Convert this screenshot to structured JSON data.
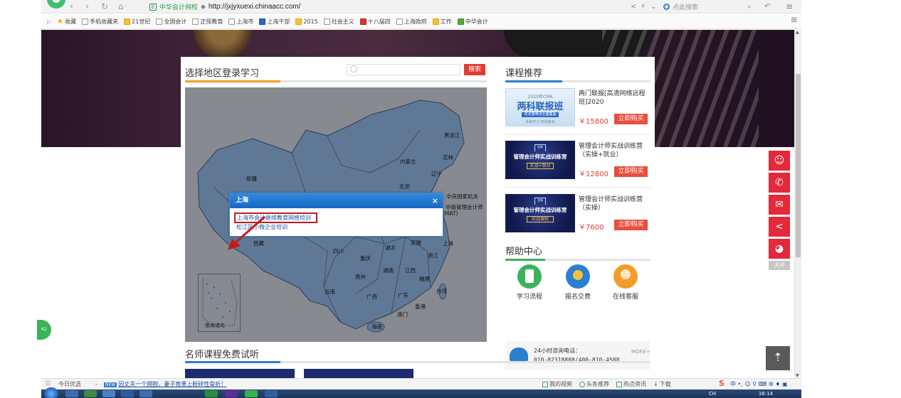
{
  "browser": {
    "site_tag": "中华会计网校",
    "url": "http://jxjyxuexi.chinaacc.com/",
    "search_placeholder": "点此搜索"
  },
  "bookmarks": [
    {
      "label": "收藏",
      "icon": "star"
    },
    {
      "label": "手机收藏夹",
      "icon": "box"
    },
    {
      "label": "21世纪",
      "icon": "yellow"
    },
    {
      "label": "全国会计",
      "icon": "box"
    },
    {
      "label": "正保教育",
      "icon": "box"
    },
    {
      "label": "上海市",
      "icon": "box"
    },
    {
      "label": "上海干部",
      "icon": "blue"
    },
    {
      "label": "2015",
      "icon": "yellow"
    },
    {
      "label": "社会主义",
      "icon": "box"
    },
    {
      "label": "十八届四",
      "icon": "red"
    },
    {
      "label": "上海政府",
      "icon": "box"
    },
    {
      "label": "工作",
      "icon": "yellow"
    },
    {
      "label": "中华会计",
      "icon": "green"
    }
  ],
  "region_section": {
    "title": "选择地区登录学习",
    "search_button": "搜索",
    "accent_color": "#f39c28"
  },
  "map": {
    "provinces": [
      {
        "name": "黑龙江"
      },
      {
        "name": "吉林"
      },
      {
        "name": "内蒙古"
      },
      {
        "name": "辽宁"
      },
      {
        "name": "新疆"
      },
      {
        "name": "北京"
      },
      {
        "name": "四川"
      },
      {
        "name": "重庆"
      },
      {
        "name": "湖北"
      },
      {
        "name": "安徽"
      },
      {
        "name": "上海"
      },
      {
        "name": "浙江"
      },
      {
        "name": "贵州"
      },
      {
        "name": "湖南"
      },
      {
        "name": "江西"
      },
      {
        "name": "福建"
      },
      {
        "name": "云南"
      },
      {
        "name": "广西"
      },
      {
        "name": "广东"
      },
      {
        "name": "台湾"
      },
      {
        "name": "香港"
      },
      {
        "name": "澳门"
      },
      {
        "name": "海南"
      },
      {
        "name": "西藏"
      },
      {
        "name": "中央国家机关"
      },
      {
        "name": "中级管理会计师"
      },
      {
        "name": "(MAT)"
      }
    ],
    "inset_caption": "南海诸岛"
  },
  "popup": {
    "title": "上海",
    "close": "×",
    "links": [
      "上海市会计继续教育网络培训",
      "松江区小微企业培训"
    ]
  },
  "course_section": {
    "title": "课程推荐",
    "accent_color": "#2a7fd0",
    "courses": [
      {
        "title": "两门联报[高清网络远程班]2020",
        "price": "￥15800",
        "buy": "立即购买",
        "thumb_top": "2020年CMA",
        "thumb_main": "两科联报班",
        "thumb_sub": "考点重难点全面覆盖",
        "thumb_foot": "系统学习 高效备考"
      },
      {
        "title": "管理会计师实战训练营（实操+就业）",
        "price": "￥12800",
        "buy": "立即购买",
        "thumb_main": "管理会计师实战训练营",
        "thumb_tag": "实战+就业",
        "thumb_badge": "全新"
      },
      {
        "title": "管理会计师实战训练营（实操）",
        "price": "￥7600",
        "buy": "立即购买",
        "thumb_main": "管理会计师实战训练营",
        "thumb_tag": "实战课程",
        "thumb_badge": "全新"
      }
    ]
  },
  "help_section": {
    "title": "帮助中心",
    "accent_color": "#3ab35a",
    "items": [
      {
        "label": "学习流程",
        "color": "#3ab35a"
      },
      {
        "label": "报名交费",
        "color": "#2a7fd0"
      },
      {
        "label": "在线客服",
        "color": "#f39c28"
      }
    ],
    "hotline_label": "24小时咨询电话：",
    "hotline_numbers": "010-82318888/400-810-4588"
  },
  "teacher_section": {
    "title": "名师课程免费试听",
    "more": "MORE+",
    "accent_color": "#2a7fd0"
  },
  "side_bar": {
    "close": "关闭",
    "color": "#e3293a"
  },
  "float_left": {
    "label": "62"
  },
  "status_bar": {
    "today": "今日优选",
    "news_tag": "NEW",
    "news": "因丈夫一个拥抱，妻子竟患上粉碎性骨折！",
    "right_items": [
      "我的视频",
      "头条推荐",
      "热点资讯",
      "下载"
    ]
  },
  "taskbar": {
    "lang": "CH",
    "time": "16:14"
  }
}
